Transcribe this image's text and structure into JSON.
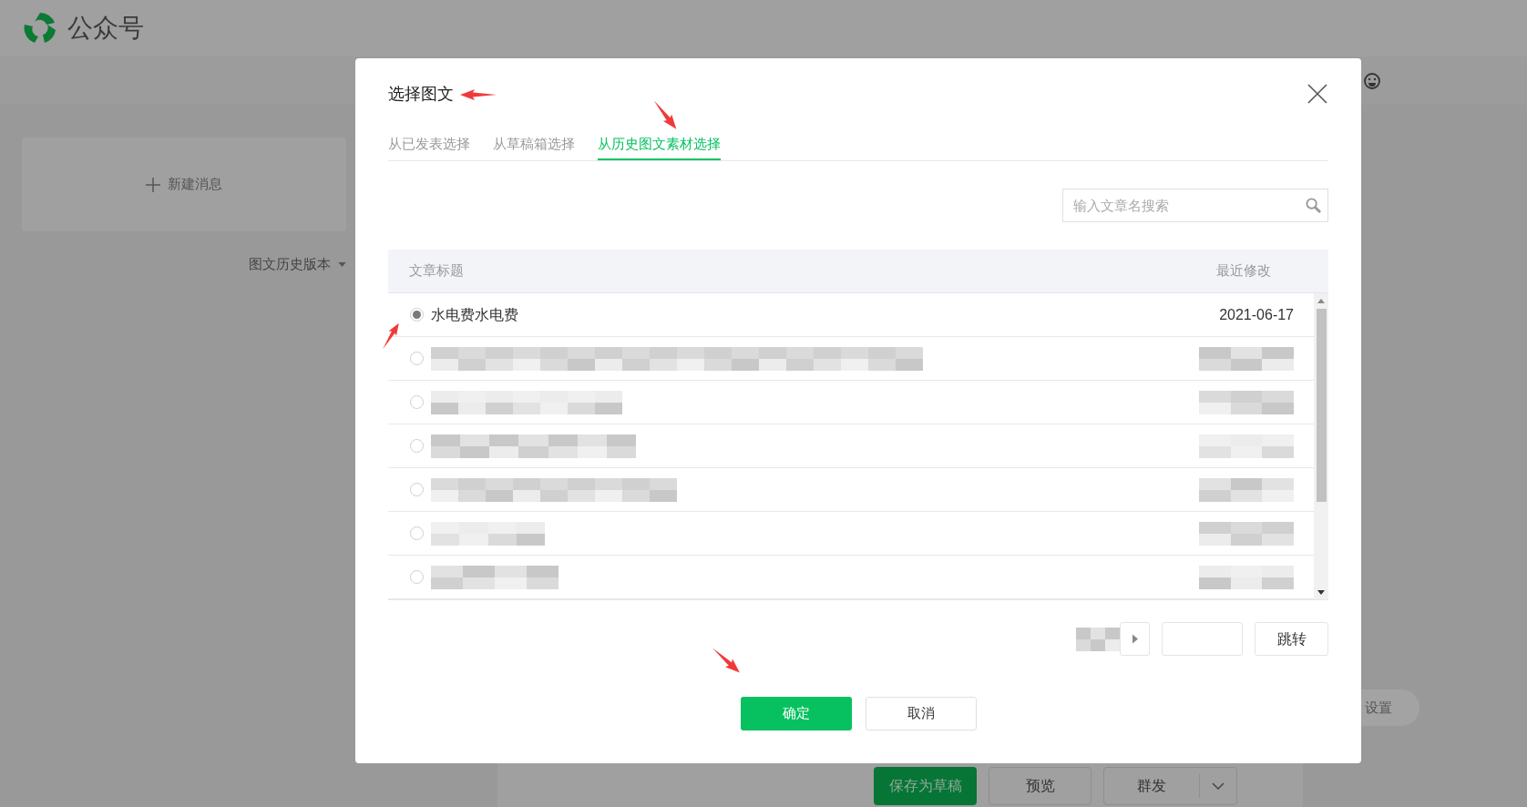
{
  "app": {
    "name": "公众号"
  },
  "background": {
    "new_message": "新建消息",
    "history_versions": "图文历史版本",
    "settings": "设置",
    "actions": [
      {
        "label": "保存为草稿",
        "kind": "primary"
      },
      {
        "label": "预览",
        "kind": "default"
      },
      {
        "label": "群发",
        "kind": "split"
      }
    ]
  },
  "dialog": {
    "title": "选择图文",
    "tabs": [
      {
        "label": "从已发表选择",
        "selected": false
      },
      {
        "label": "从草稿箱选择",
        "selected": false
      },
      {
        "label": "从历史图文素材选择",
        "selected": true
      }
    ],
    "search": {
      "placeholder": "输入文章名搜索"
    },
    "table": {
      "columns": [
        "文章标题",
        "最近修改"
      ],
      "rows": [
        {
          "kind": "text",
          "title": "水电费水电费",
          "modified": "2021-06-17",
          "selected": true
        },
        {
          "kind": "redacted",
          "selected": false
        },
        {
          "kind": "redacted",
          "selected": false
        },
        {
          "kind": "redacted",
          "selected": false
        },
        {
          "kind": "redacted",
          "selected": false
        },
        {
          "kind": "redacted",
          "selected": false
        },
        {
          "kind": "redacted",
          "selected": false
        }
      ]
    },
    "pagination": {
      "jump": "跳转"
    },
    "buttons": [
      {
        "label": "确定",
        "kind": "primary"
      },
      {
        "label": "取消",
        "kind": "default"
      }
    ]
  }
}
